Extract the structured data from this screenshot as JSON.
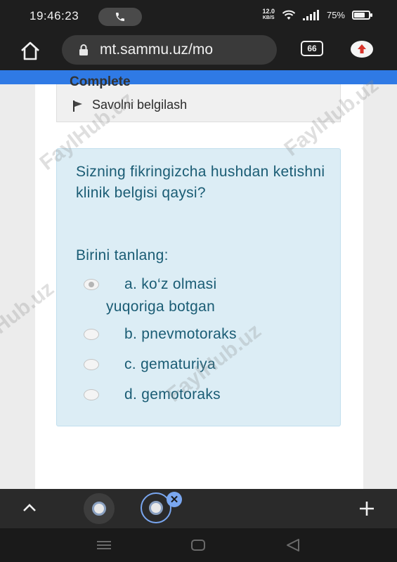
{
  "status_bar": {
    "time": "19:46:23",
    "net_speed_value": "12.0",
    "net_speed_unit": "KB/S",
    "battery_percent": "75%",
    "battery_level": 0.75
  },
  "browser": {
    "url": "mt.sammu.uz/mo",
    "tab_count": "66"
  },
  "page": {
    "partial_heading": "Complete",
    "flag_label": "Savolni belgilash",
    "question": "Sizning fikringizcha hushdan ketishni klinik belgisi qaysi?",
    "prompt": "Birini tanlang:",
    "answers": [
      {
        "line1": "a. ko‘z olmasi",
        "line2": "yuqoriga botgan",
        "selected": true
      },
      {
        "line1": "b. pnevmotoraks",
        "line2": "",
        "selected": false
      },
      {
        "line1": "c. gematuriya",
        "line2": "",
        "selected": false
      },
      {
        "line1": "d. gemotoraks",
        "line2": "",
        "selected": false
      }
    ]
  },
  "watermark": "FaylHub.uz",
  "tab_strip": {
    "close_symbol": "✕"
  },
  "colors": {
    "accent_blue": "#2f7ae5",
    "question_bg": "#dcedf5",
    "question_text": "#1a5c74"
  }
}
